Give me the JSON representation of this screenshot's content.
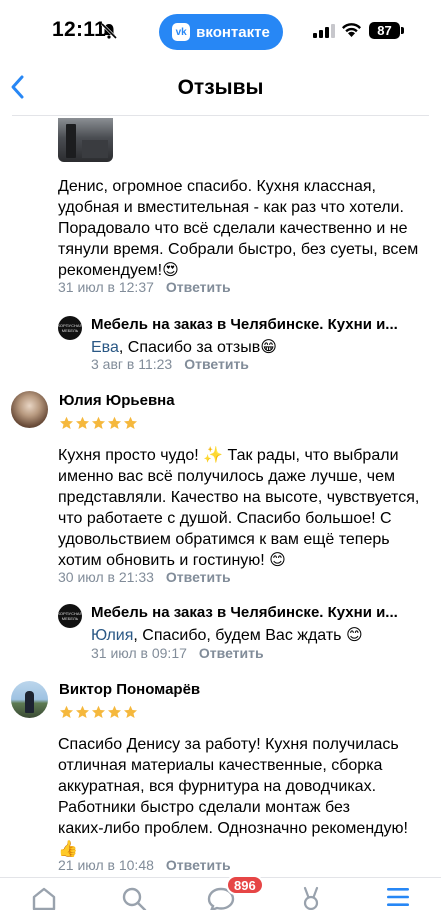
{
  "status_bar": {
    "time": "12:11",
    "app_pill": "вконтакте",
    "app_logo": "vk",
    "battery": "87",
    "icons": [
      "bell-slash-icon",
      "signal-icon",
      "wifi-icon",
      "battery-icon"
    ]
  },
  "header": {
    "title": "Отзывы",
    "back_icon": "chevron-left-icon"
  },
  "reply_action": "Ответить",
  "reviews": [
    {
      "text_lines": [
        "Денис, огромное спасибо. Кухня классная,",
        "удобная и вместительная - как раз что хотели.",
        "Порадовало что всё сделали качественно и не",
        "тянули время. Собрали быстро, без суеты, всем",
        "рекомендуем!😍"
      ],
      "date": "31 июл в 12:37",
      "reply": {
        "author": "Мебель на заказ в Челябинске. Кухни и...",
        "mention": "Ева",
        "text": ", Спасибо за отзыв😁",
        "date": "3 авг в 11:23"
      }
    },
    {
      "author": "Юлия Юрьевна",
      "rating": 5,
      "text_lines": [
        "Кухня просто чудо! ✨ Так рады, что выбрали",
        "именно вас всё получилось даже лучше, чем",
        "представляли. Качество на высоте, чувствуется,",
        "что работаете с душой. Спасибо большое! С",
        "удовольствием обратимся к вам ещё теперь",
        "хотим обновить и гостиную! 😊"
      ],
      "date": "30 июл в 21:33",
      "reply": {
        "author": "Мебель на заказ в Челябинске. Кухни и...",
        "mention": "Юлия",
        "text": ", Спасибо, будем Вас ждать 😊",
        "date": "31 июл в 09:17"
      }
    },
    {
      "author": "Виктор Пономарёв",
      "rating": 5,
      "text_lines": [
        "Спасибо Денису за работу! Кухня получилась",
        "отличная материалы качественные, сборка",
        "аккуратная, вся фурнитура на доводчиках.",
        "Работники быстро сделали монтаж без",
        "каких-либо проблем. Однозначно рекомендую!",
        "👍"
      ],
      "date": "21 июл в 10:48"
    }
  ],
  "tab_bar": {
    "tabs": [
      "home-icon",
      "search-icon",
      "messages-icon",
      "clips-icon",
      "menu-icon"
    ],
    "messages_badge": "896"
  },
  "colors": {
    "accent": "#2787f5",
    "link": "#2a5885",
    "meta": "#818c99",
    "star": "#f5b83d",
    "badge": "#e64646"
  }
}
